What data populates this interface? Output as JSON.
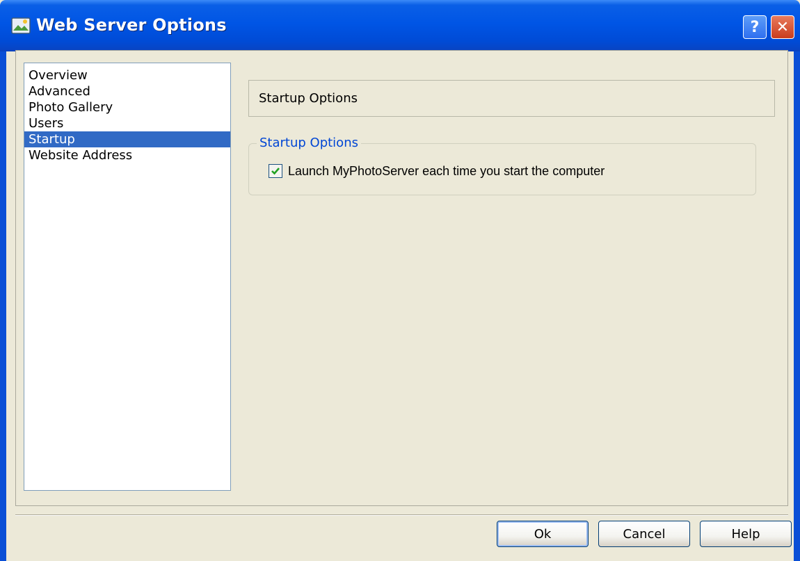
{
  "window": {
    "title": "Web Server Options"
  },
  "titlebar_buttons": {
    "help_label": "?",
    "close_label": "✕"
  },
  "nav": {
    "items": [
      {
        "label": "Overview"
      },
      {
        "label": "Advanced"
      },
      {
        "label": "Photo Gallery"
      },
      {
        "label": "Users"
      },
      {
        "label": "Startup",
        "selected": true
      },
      {
        "label": "Website Address"
      }
    ]
  },
  "panel": {
    "header": "Startup Options",
    "group_title": "Startup Options",
    "checkbox_label": "Launch MyPhotoServer each time you start the computer",
    "checkbox_checked": true
  },
  "buttons": {
    "ok": "Ok",
    "cancel": "Cancel",
    "help": "Help"
  },
  "colors": {
    "titlebar": "#0055e5",
    "selection": "#316ac5",
    "group_title": "#0046d5"
  },
  "icons": {
    "app": "web-server-icon",
    "checkmark": "checkmark-icon"
  }
}
